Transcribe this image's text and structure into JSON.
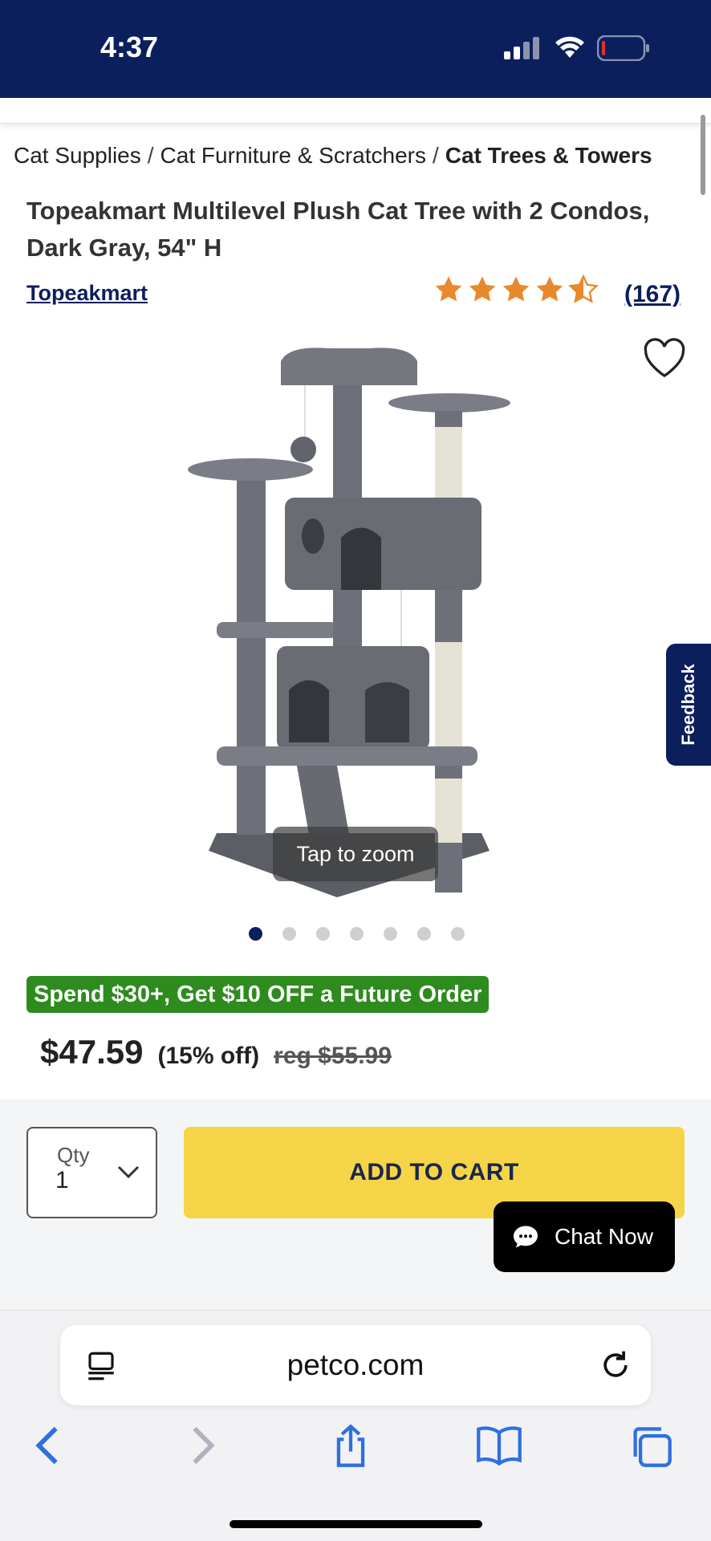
{
  "status_bar": {
    "time": "4:37"
  },
  "breadcrumb": {
    "items": [
      "Cat Supplies",
      "Cat Furniture & Scratchers"
    ],
    "current": "Cat Trees & Towers",
    "separator": "/"
  },
  "product": {
    "title": "Topeakmart Multilevel Plush Cat Tree with 2 Condos, Dark Gray, 54\" H",
    "brand": "Topeakmart",
    "rating": 4.5,
    "rating_max": 5,
    "review_count": "(167)",
    "zoom_hint": "Tap to zoom",
    "image_count": 7,
    "active_image": 1
  },
  "promo": {
    "text": "Spend $30+, Get $10 OFF a Future Order",
    "color": "#2e8b1e"
  },
  "pricing": {
    "price": "$47.59",
    "discount": "(15% off)",
    "regular": "reg $55.99"
  },
  "cart": {
    "qty_label": "Qty",
    "qty_value": "1",
    "add_label": "ADD TO CART",
    "button_color": "#f5d547"
  },
  "feedback": {
    "label": "Feedback"
  },
  "chat": {
    "label": "Chat Now"
  },
  "browser": {
    "url": "petco.com"
  },
  "colors": {
    "brand_navy": "#0b1f5c",
    "star": "#e8892b"
  }
}
